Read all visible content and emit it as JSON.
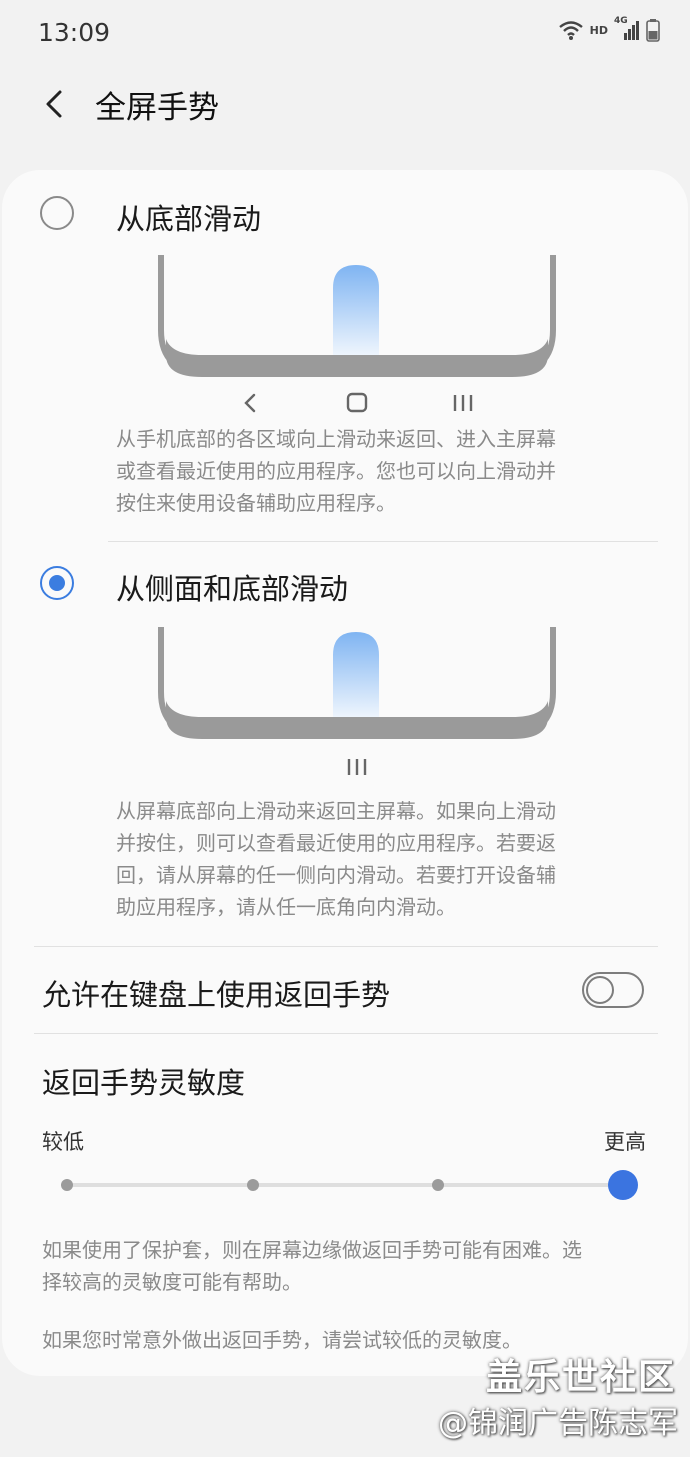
{
  "status_bar": {
    "time": "13:09",
    "hd": "HD",
    "network": "4G"
  },
  "header": {
    "title": "全屏手势"
  },
  "options": [
    {
      "label": "从底部滑动",
      "selected": false,
      "description": [
        "从手机底部的各区域向上滑动来返回、进入主屏幕",
        "或查看最近使用的应用程序。您也可以向上滑动并",
        "按住来使用设备辅助应用程序。"
      ]
    },
    {
      "label": "从侧面和底部滑动",
      "selected": true,
      "description": [
        "从屏幕底部向上滑动来返回主屏幕。如果向上滑动",
        "并按住，则可以查看最近使用的应用程序。若要返",
        "回，请从屏幕的任一侧向内滑动。若要打开设备辅",
        "助应用程序，请从任一底角向内滑动。"
      ]
    }
  ],
  "keyboard_gesture": {
    "label": "允许在键盘上使用返回手势",
    "enabled": false
  },
  "sensitivity": {
    "title": "返回手势灵敏度",
    "low_label": "较低",
    "high_label": "更高",
    "steps": 4,
    "value_step": 4,
    "note1": [
      "如果使用了保护套，则在屏幕边缘做返回手势可能有困难。选",
      "择较高的灵敏度可能有帮助。"
    ],
    "note2": "如果您时常意外做出返回手势，请尝试较低的灵敏度。"
  },
  "watermark": {
    "line1": "盖乐世社区",
    "line2": "@锦润广告陈志军"
  },
  "colors": {
    "accent": "#3b7de0",
    "gesture_bar": "#8fc0f5",
    "phone_frame": "#9a9a9a"
  }
}
